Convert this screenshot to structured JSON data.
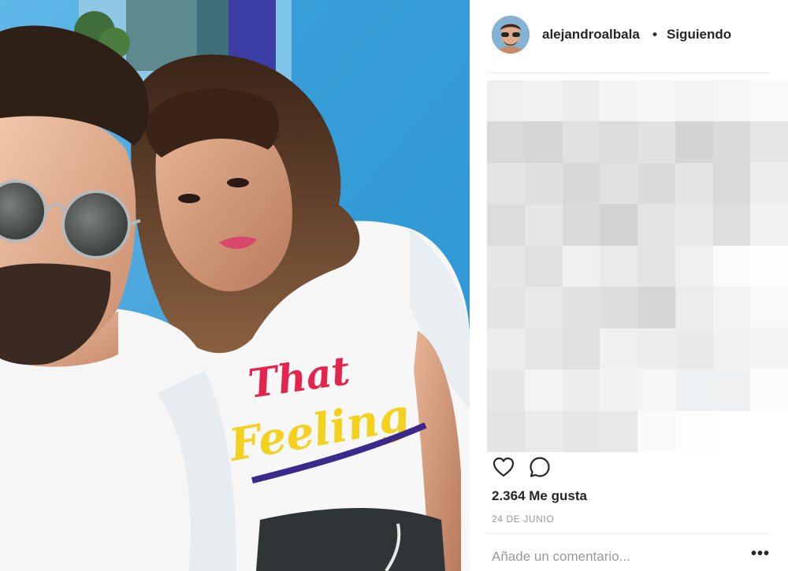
{
  "header": {
    "username": "alejandroalbala",
    "separator": "•",
    "follow_status": "Siguiendo",
    "avatar_icon": "user-avatar-icon"
  },
  "actions": {
    "like_icon": "heart-outline-icon",
    "comment_icon": "speech-bubble-icon"
  },
  "stats": {
    "likes_label": "2.364 Me gusta",
    "date_label": "24 DE JUNIO"
  },
  "comment_box": {
    "placeholder": "Añade un comentario...",
    "more_label": "•••"
  },
  "colors": {
    "text_primary": "#262626",
    "text_secondary": "#999999",
    "divider": "#efefef",
    "pixelated_light": "#f0f0f0",
    "pixelated_dark": "#cfcfcf"
  }
}
